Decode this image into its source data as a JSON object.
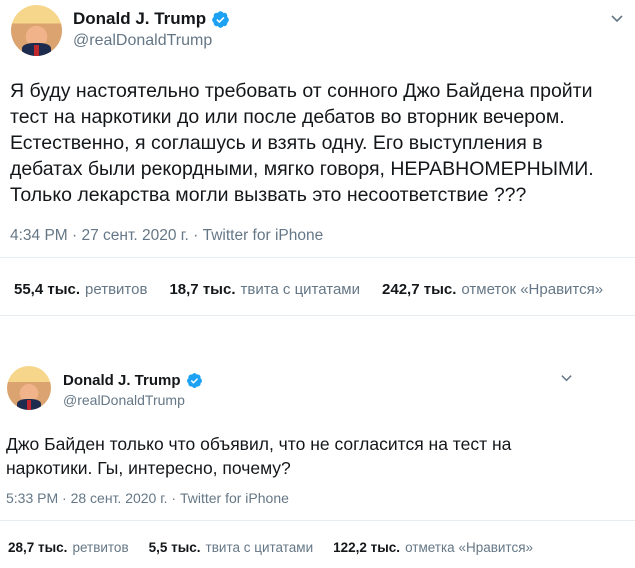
{
  "tweets": [
    {
      "author": {
        "name": "Donald J. Trump",
        "handle": "@realDonaldTrump",
        "verified": true
      },
      "text": "Я буду настоятельно требовать от сонного Джо Байдена пройти\nтест на наркотики до или после дебатов во вторник вечером.\nЕстественно, я соглашусь и взять одну. Его выступления в\nдебатах были рекордными, мягко говоря, НЕРАВНОМЕРНЫМИ.\nТолько лекарства могли вызвать это несоответствие ???",
      "meta": "4:34 PM · 27 сент. 2020 г. · Twitter for iPhone",
      "stats": {
        "retweets": {
          "value": "55,4 тыс.",
          "label": "ретвитов"
        },
        "quotes": {
          "value": "18,7 тыс.",
          "label": "твита с цитатами"
        },
        "likes": {
          "value": "242,7 тыс.",
          "label": "отметок «Нравится»"
        }
      }
    },
    {
      "author": {
        "name": "Donald J. Trump",
        "handle": "@realDonaldTrump",
        "verified": true
      },
      "text": "Джо Байден только что объявил, что не согласится на тест на\nнаркотики. Гы, интересно, почему?",
      "meta": "5:33 PM · 28 сент. 2020 г. · Twitter for iPhone",
      "stats": {
        "retweets": {
          "value": "28,7 тыс.",
          "label": "ретвитов"
        },
        "quotes": {
          "value": "5,5 тыс.",
          "label": "твита с цитатами"
        },
        "likes": {
          "value": "122,2 тыс.",
          "label": "отметка «Нравится»"
        }
      }
    }
  ],
  "colors": {
    "verified": "#1da1f2",
    "secondary_text": "#657786",
    "divider": "#e6ecf0"
  },
  "icons": {
    "verified": "verified-badge-icon",
    "caret": "chevron-down-icon"
  }
}
